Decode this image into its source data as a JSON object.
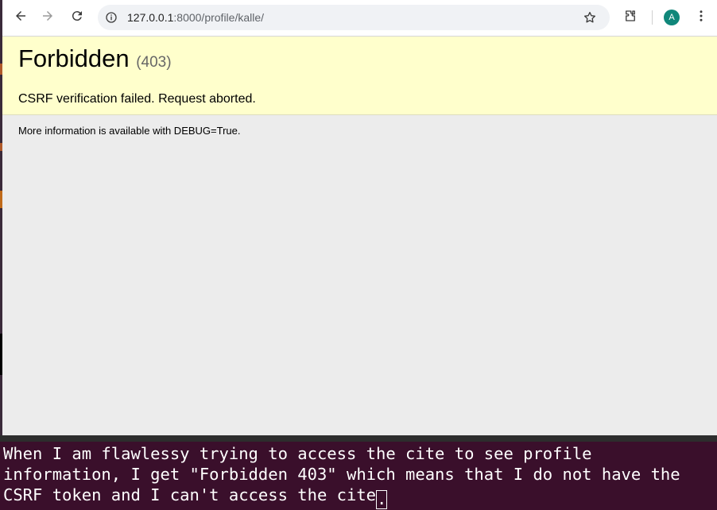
{
  "browser": {
    "url_host": "127.0.0.1",
    "url_rest": ":8000/profile/kalle/",
    "avatar_letter": "A",
    "avatar_color": "#10877a",
    "icons": [
      "back-arrow-icon",
      "forward-arrow-icon",
      "reload-icon",
      "site-info-icon",
      "bookmark-star-icon",
      "extensions-icon",
      "more-menu-icon"
    ]
  },
  "page": {
    "title": "Forbidden",
    "status_code": "(403)",
    "reason": "CSRF verification failed. Request aborted.",
    "info": "More information is available with DEBUG=True.",
    "summary_bg": "#ffffcc",
    "body_bg": "#ececec"
  },
  "terminal": {
    "text": "When I am flawlessy trying to access the cite to see profile information, I get \"Forbidden 403\" which means that I do not have the CSRF token and I can't access the cite",
    "cursor_char": ".",
    "bg": "#3a0f2b"
  }
}
